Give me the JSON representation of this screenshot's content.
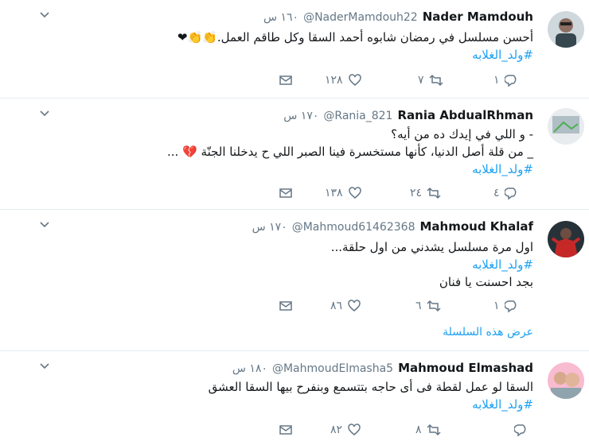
{
  "tweets": [
    {
      "name": "Nader Mamdouh",
      "handle": "@NaderMamdouh22",
      "time": "١٦٠ س",
      "lines": [
        "أحسن مسلسل في رمضان شابوه أحمد السقا وكل طاقم العمل."
      ],
      "emoji": "👏👏❤",
      "hashtag": "#ولد_الغلابه",
      "replies": "١",
      "retweets": "٧",
      "likes": "١٢٨"
    },
    {
      "name": "Rania AbdualRhman",
      "handle": "@Rania_821",
      "time": "١٧٠ س",
      "lines": [
        "- و اللي في إيدك ده من أيه؟",
        "_ من قلة أصل الدنيا، كأنها مستخسرة فينا الصبر اللي ح يدخلنا الجنّة"
      ],
      "emoji": "💔 ...",
      "hashtag": "#ولد_الغلابه",
      "replies": "٤",
      "retweets": "٢٤",
      "likes": "١٣٨"
    },
    {
      "name": "Mahmoud Khalaf",
      "handle": "@Mahmoud61462368",
      "time": "١٧٠ س",
      "lines": [
        "اول مرة مسلسل يشدني من اول حلقة..."
      ],
      "emoji": "",
      "hashtag": "#ولد_الغلابه",
      "extra": "بجد احسنت يا فنان",
      "replies": "١",
      "retweets": "٦",
      "likes": "٨٦"
    },
    {
      "name": "Mahmoud Elmashad",
      "handle": "@MahmoudElmasha5",
      "time": "١٨٠ س",
      "lines": [
        "السقا لو عمل لقطة فى أى حاجه بتتسمع وبنفرح بيها السقا العشق"
      ],
      "emoji": "",
      "hashtag": "#ولد_الغلابه",
      "replies": "",
      "retweets": "٨",
      "likes": "٨٢"
    }
  ],
  "thread_link": "عرض هذه السلسلة",
  "colors": {
    "accent": "#1da1f2",
    "muted": "#657786",
    "border": "#e6ecf0"
  }
}
